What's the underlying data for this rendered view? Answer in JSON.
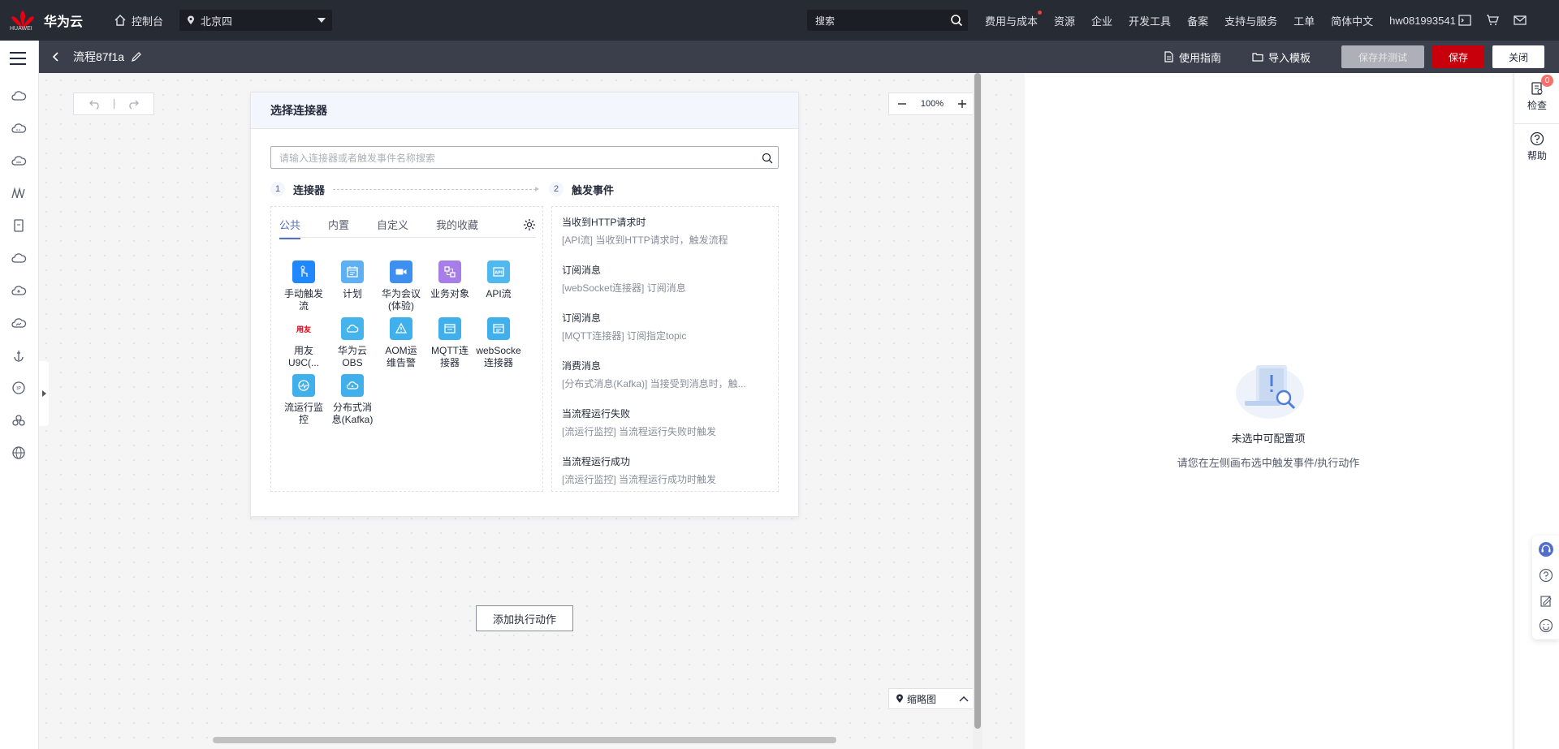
{
  "topnav": {
    "brand": "华为云",
    "brand_sub": "HUAWEI",
    "console_label": "控制台",
    "region": "北京四",
    "search_placeholder": "搜索",
    "links": [
      {
        "label": "费用与成本",
        "dot": true
      },
      {
        "label": "资源"
      },
      {
        "label": "企业"
      },
      {
        "label": "开发工具"
      },
      {
        "label": "备案"
      },
      {
        "label": "支持与服务"
      },
      {
        "label": "工单"
      },
      {
        "label": "简体中文"
      },
      {
        "label": "hw081993541"
      }
    ],
    "icons": [
      "terminal-icon",
      "cart-icon",
      "mail-icon"
    ]
  },
  "subheader": {
    "flow_name": "流程87f1a",
    "guide_label": "使用指南",
    "import_label": "导入模板",
    "save_test_label": "保存并测试",
    "save_label": "保存",
    "close_label": "关闭"
  },
  "canvas": {
    "zoom": "100%",
    "add_action_label": "添加执行动作",
    "minimap_label": "缩略图"
  },
  "panel": {
    "title": "选择连接器",
    "search_placeholder": "请输入连接器或者触发事件名称搜索",
    "step1_num": "1",
    "step1_label": "连接器",
    "step2_num": "2",
    "step2_label": "触发事件",
    "tabs": [
      "公共",
      "内置",
      "自定义",
      "我的收藏"
    ],
    "connectors": [
      {
        "label": "手动触发\n流",
        "color": "#1f87ff",
        "icon": "hand-touch-icon"
      },
      {
        "label": "计划",
        "color": "#5eb0f5",
        "icon": "calendar-icon"
      },
      {
        "label": "华为会议\n(体验)",
        "color": "#3d8ff0",
        "icon": "video-camera-icon"
      },
      {
        "label": "业务对象",
        "color": "#a77ee8",
        "icon": "business-object-icon"
      },
      {
        "label": "API流",
        "color": "#4fb8ee",
        "icon": "api-icon"
      },
      {
        "label": "用友\nU9C(...",
        "color": "#ffffff",
        "icon": "yonyou-logo-icon",
        "badge": "用友"
      },
      {
        "label": "华为云\nOBS",
        "color": "#45b4ec",
        "icon": "cloud-storage-icon"
      },
      {
        "label": "AOM运\n维告警",
        "color": "#3fb0ec",
        "icon": "alarm-icon"
      },
      {
        "label": "MQTT连\n接器",
        "color": "#3fb0ec",
        "icon": "mqtt-icon"
      },
      {
        "label": "webSocke\n连接器",
        "color": "#3fb0ec",
        "icon": "websocket-icon"
      },
      {
        "label": "流运行监\n控",
        "color": "#3fb0ec",
        "icon": "monitor-icon"
      },
      {
        "label": "分布式消\n息(Kafka)",
        "color": "#3fb0ec",
        "icon": "kafka-icon"
      }
    ],
    "events": [
      {
        "title": "当收到HTTP请求时",
        "desc": "[API流] 当收到HTTP请求时，触发流程"
      },
      {
        "title": "订阅消息",
        "desc": "[webSocket连接器] 订阅消息"
      },
      {
        "title": "订阅消息",
        "desc": "[MQTT连接器] 订阅指定topic"
      },
      {
        "title": "消费消息",
        "desc": "[分布式消息(Kafka)] 当接受到消息时，触..."
      },
      {
        "title": "当流程运行失败",
        "desc": "[流运行监控] 当流程运行失败时触发"
      },
      {
        "title": "当流程运行成功",
        "desc": "[流运行监控] 当流程运行成功时触发"
      }
    ]
  },
  "rightpanel": {
    "empty_title": "未选中可配置项",
    "empty_desc": "请您在左侧画布选中触发事件/执行动作"
  },
  "rightstrip": {
    "check_label": "检查",
    "check_badge": "0",
    "help_label": "帮助"
  },
  "colors": {
    "topnav_bg": "#272b34",
    "subheader_bg": "#3a3f4b",
    "primary_red": "#c7000b",
    "tab_active": "#526ecc"
  }
}
